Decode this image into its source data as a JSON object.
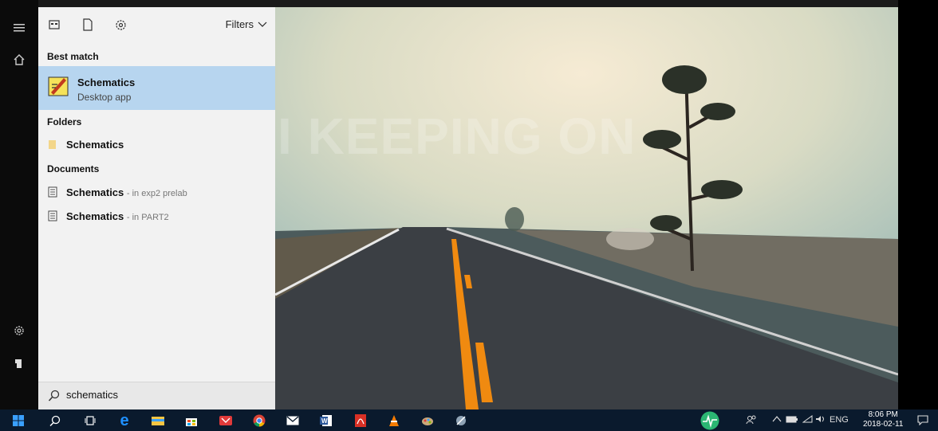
{
  "wallpaper": {
    "text": "I KEEPING ON"
  },
  "rail": {
    "icons": [
      "hamburger-icon",
      "home-icon",
      "settings-icon",
      "user-icon"
    ]
  },
  "start_panel": {
    "toolbar": {
      "filters_label": "Filters",
      "icons": [
        "apps-icon",
        "document-icon",
        "gear-icon"
      ]
    },
    "best_match": {
      "heading": "Best match",
      "title": "Schematics",
      "subtitle": "Desktop app",
      "icon": "schematics-app-icon"
    },
    "folders": {
      "heading": "Folders",
      "items": [
        {
          "title": "Schematics",
          "icon": "folder-icon"
        }
      ]
    },
    "documents": {
      "heading": "Documents",
      "items": [
        {
          "title": "Schematics",
          "location": "- in exp2 prelab",
          "icon": "document-file-icon"
        },
        {
          "title": "Schematics",
          "location": "- in PART2",
          "icon": "document-file-icon"
        }
      ]
    },
    "search": {
      "value": "schematics",
      "icon": "search-icon"
    }
  },
  "taskbar": {
    "apps": [
      "windows-start-icon",
      "cortana-search-icon",
      "task-view-icon",
      "edge-icon",
      "file-explorer-icon",
      "store-icon",
      "mail-red-icon",
      "chrome-icon",
      "mail-icon",
      "word-icon",
      "acrobat-icon",
      "vlc-icon",
      "paint-icon",
      "utility-icon",
      "activity-monitor-icon"
    ],
    "tray": {
      "language": "ENG",
      "time": "8:06 PM",
      "date": "2018-02-11"
    },
    "colors": {
      "background": "#0a1a2d",
      "highlight": "#b7d5ef",
      "accent": "#1e90ff"
    }
  }
}
